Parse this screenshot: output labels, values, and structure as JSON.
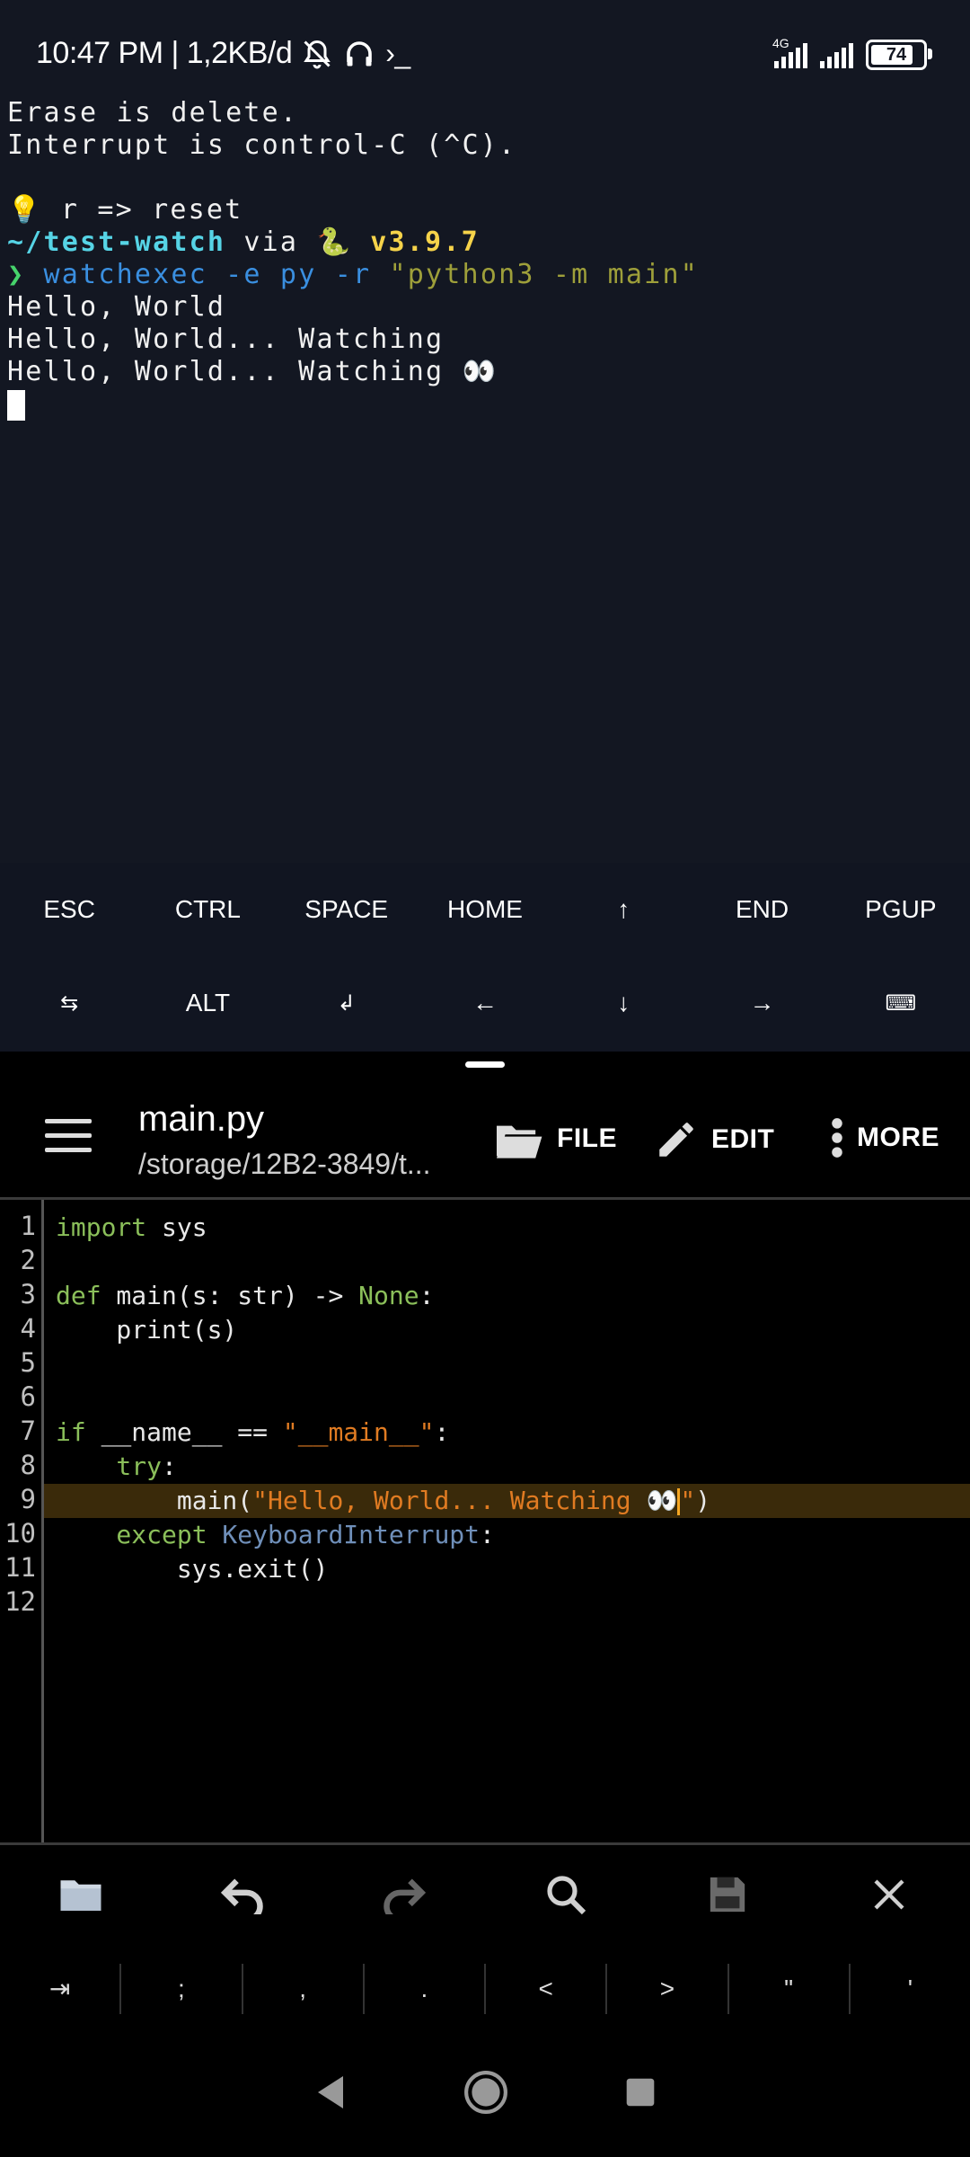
{
  "status_bar": {
    "time_speed": "10:47 PM | 1,2KB/d",
    "net_label": "4G",
    "battery": "74"
  },
  "terminal": {
    "line1": "Erase is delete.",
    "line2": "Interrupt is control-C (^C).",
    "tip_text": " r => reset",
    "prompt_dir": "~/test-watch",
    "prompt_via": " via ",
    "prompt_version": " v3.9.7",
    "cmd_name": "watchexec",
    "cmd_flags": " -e py -r ",
    "cmd_string": "\"python3 -m main\"",
    "out1": "Hello, World",
    "out2": "Hello, World... Watching",
    "out3": "Hello, World... Watching "
  },
  "extra_keys": {
    "row1": [
      "ESC",
      "CTRL",
      "SPACE",
      "HOME",
      "↑",
      "END",
      "PGUP"
    ],
    "row2": [
      "⇆",
      "ALT",
      "↲",
      "←",
      "↓",
      "→",
      "⌨"
    ]
  },
  "editor_toolbar": {
    "file_name": "main.py",
    "file_path": "/storage/12B2-3849/t...",
    "file_label": "FILE",
    "edit_label": "EDIT",
    "more_label": "MORE"
  },
  "editor": {
    "line_numbers": [
      "1",
      "2",
      "3",
      "4",
      "5",
      "6",
      "7",
      "8",
      "9",
      "10",
      "11",
      "12"
    ],
    "l1_kw": "import",
    "l1_rest": " sys",
    "l3_kw": "def",
    "l3_a": " main(s: str) -> ",
    "l3_none": "None",
    "l3_b": ":",
    "l4": "    print(s)",
    "l7_kw": "if",
    "l7_a": " __name__ == ",
    "l7_str": "\"__main__\"",
    "l7_b": ":",
    "l8_kw": "    try",
    "l8_b": ":",
    "l9_a": "        main(",
    "l9_str": "\"Hello, World... Watching ",
    "l9_str_end": "\"",
    "l9_b": ")",
    "l10_kw": "    except",
    "l10_cls": " KeyboardInterrupt",
    "l10_b": ":",
    "l11": "        sys.exit()"
  },
  "symbol_bar": [
    "⇥",
    ";",
    ",",
    ".",
    "<",
    ">",
    "\"",
    "'"
  ]
}
